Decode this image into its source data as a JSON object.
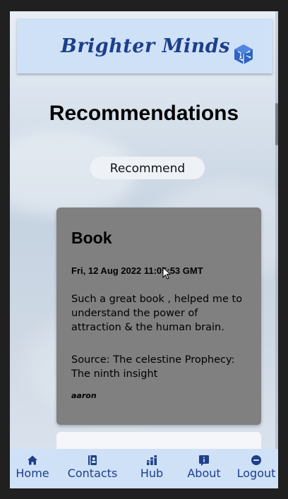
{
  "header": {
    "brand": "Brighter Minds",
    "logo_icon": "cube-logo-icon",
    "accent": "#1d3f8a",
    "bg": "#cfe1f7"
  },
  "page": {
    "title": "Recommendations"
  },
  "recommend_button": {
    "label": "Recommend"
  },
  "recommendations": [
    {
      "type": "Book",
      "date": "Fri, 12 Aug 2022 11:05:53 GMT",
      "text": "Such a great book , helped me to understand the power of attraction & the human brain.",
      "source": "Source: The celestine Prophecy: The ninth insight",
      "author": "aaron",
      "bg": "#808080"
    }
  ],
  "nav": {
    "items": [
      {
        "label": "Home",
        "icon": "home-icon"
      },
      {
        "label": "Contacts",
        "icon": "contacts-icon"
      },
      {
        "label": "Hub",
        "icon": "hub-icon"
      },
      {
        "label": "About",
        "icon": "info-icon"
      },
      {
        "label": "Logout",
        "icon": "logout-icon"
      }
    ]
  }
}
